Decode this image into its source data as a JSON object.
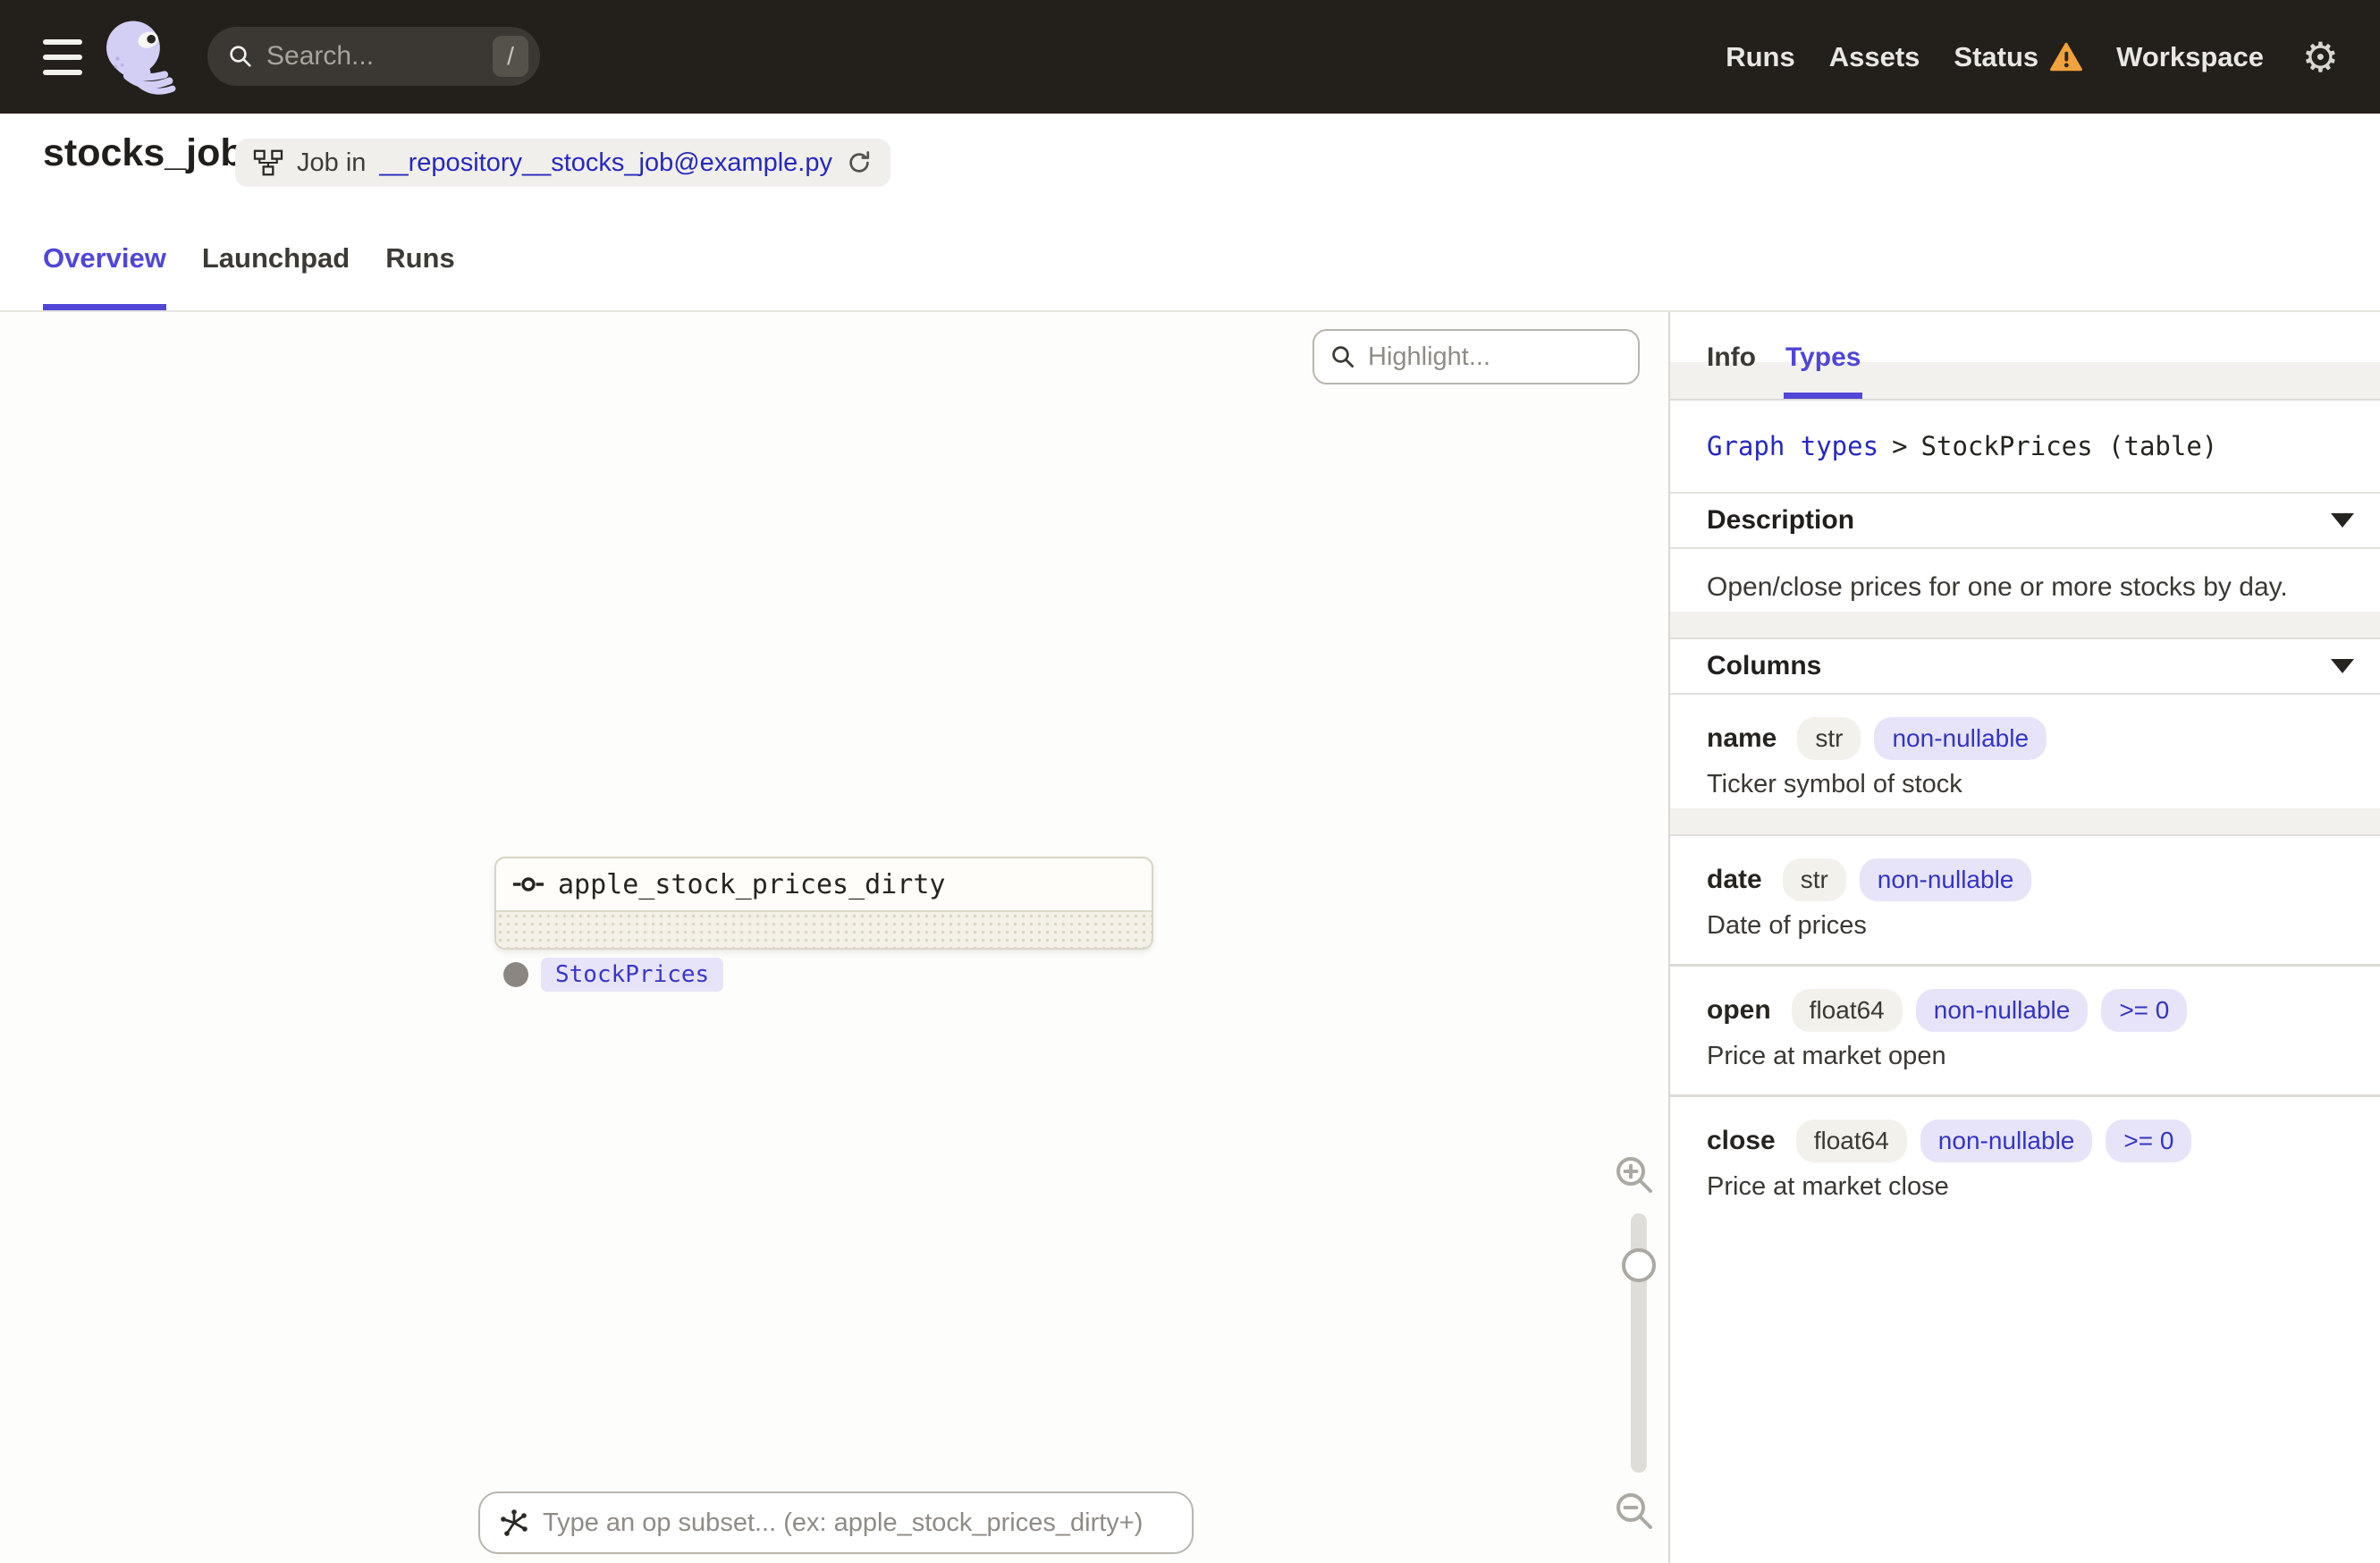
{
  "topbar": {
    "search_placeholder": "Search...",
    "search_shortcut": "/",
    "nav": [
      {
        "label": "Runs"
      },
      {
        "label": "Assets"
      },
      {
        "label": "Status",
        "warning": true
      },
      {
        "label": "Workspace"
      }
    ],
    "icons": {
      "gear_glyph": "⚙"
    }
  },
  "header": {
    "title": "stocks_job",
    "job_pill": {
      "prefix": "Job in",
      "link": "__repository__stocks_job@example.py"
    },
    "tabs": [
      {
        "label": "Overview",
        "active": true
      },
      {
        "label": "Launchpad",
        "active": false
      },
      {
        "label": "Runs",
        "active": false
      }
    ]
  },
  "canvas": {
    "highlight_placeholder": "Highlight...",
    "node": {
      "title": "apple_stock_prices_dirty",
      "output_tag": "StockPrices"
    },
    "subset_placeholder": "Type an op subset... (ex: apple_stock_prices_dirty+)"
  },
  "panel": {
    "tabs": [
      {
        "label": "Info",
        "active": false
      },
      {
        "label": "Types",
        "active": true
      }
    ],
    "breadcrumb": {
      "link": "Graph types",
      "separator": ">",
      "current": "StockPrices (table)"
    },
    "sections": {
      "description": {
        "title": "Description",
        "text": "Open/close prices for one or more stocks by day."
      },
      "columns": {
        "title": "Columns"
      }
    },
    "columns": [
      {
        "name": "name",
        "tags": [
          {
            "label": "str",
            "kind": "type"
          },
          {
            "label": "non-nullable",
            "kind": "constraint"
          }
        ],
        "description": "Ticker symbol of stock"
      },
      {
        "name": "date",
        "tags": [
          {
            "label": "str",
            "kind": "type"
          },
          {
            "label": "non-nullable",
            "kind": "constraint"
          }
        ],
        "description": "Date of prices"
      },
      {
        "name": "open",
        "tags": [
          {
            "label": "float64",
            "kind": "type"
          },
          {
            "label": "non-nullable",
            "kind": "constraint"
          },
          {
            "label": ">= 0",
            "kind": "constraint"
          }
        ],
        "description": "Price at market open"
      },
      {
        "name": "close",
        "tags": [
          {
            "label": "float64",
            "kind": "type"
          },
          {
            "label": "non-nullable",
            "kind": "constraint"
          },
          {
            "label": ">= 0",
            "kind": "constraint"
          }
        ],
        "description": "Price at market close"
      }
    ]
  },
  "colors": {
    "accent": "#5046D8",
    "link_blue": "#2629BE",
    "warning": "#F0A23C",
    "topbar_bg": "#231F1A",
    "tag_indigo_bg": "#E7E4F9",
    "tag_gray_bg": "#F3F1EC"
  }
}
